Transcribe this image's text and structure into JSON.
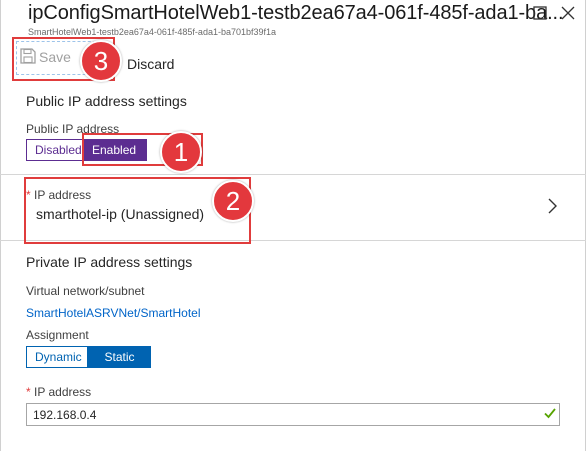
{
  "window": {
    "title": "ipConfigSmartHotelWeb1-testb2ea67a4-061f-485f-ada1-ba...",
    "subtitle": "SmartHotelWeb1-testb2ea67a4-061f-485f-ada1-ba701bf39f1a"
  },
  "toolbar": {
    "save_label": "Save",
    "discard_label": "Discard"
  },
  "callouts": {
    "one": "1",
    "two": "2",
    "three": "3"
  },
  "public_ip": {
    "heading": "Public IP address settings",
    "toggle_label": "Public IP address",
    "options": [
      "Disabled",
      "Enabled"
    ],
    "selected": "Enabled"
  },
  "ip_address_row": {
    "label": "IP address",
    "required_marker": "*",
    "value": "smarthotel-ip (Unassigned)"
  },
  "private_ip": {
    "heading": "Private IP address settings",
    "vnet_label": "Virtual network/subnet",
    "vnet_value": "SmartHotelASRVNet/SmartHotel",
    "assignment_label": "Assignment",
    "assignment_options": [
      "Dynamic",
      "Static"
    ],
    "assignment_selected": "Static",
    "ip_label": "IP address",
    "required_marker": "*",
    "ip_value": "192.168.0.4"
  },
  "icons": {
    "maximize": "square-icon",
    "close": "close-icon",
    "save": "floppy-disk-icon",
    "chevron": "chevron-right-icon",
    "check": "checkmark-icon"
  },
  "colors": {
    "callout": "#e3383d",
    "purple_accent": "#5c2d91",
    "blue_accent": "#0063b1",
    "link": "#0064c8",
    "valid_check": "#57a300"
  }
}
